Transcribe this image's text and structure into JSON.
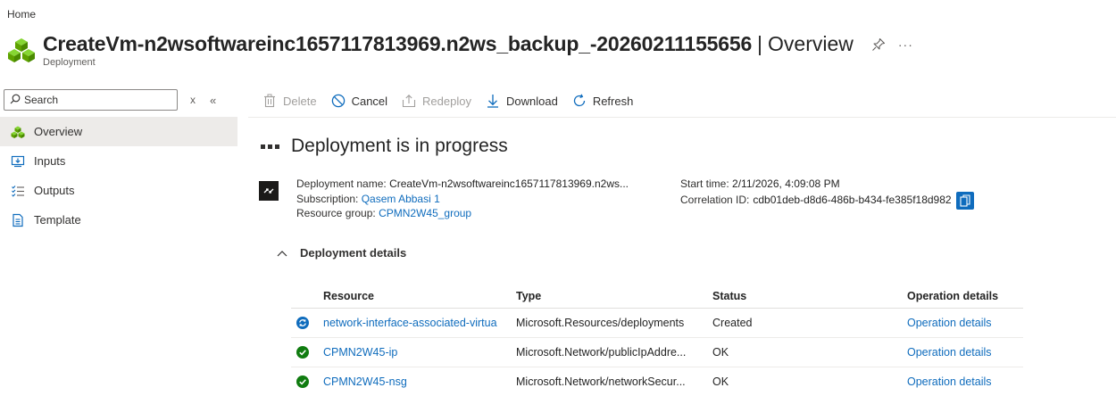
{
  "breadcrumb": {
    "home": "Home"
  },
  "header": {
    "title": "CreateVm-n2wsoftwareinc1657117813969.n2ws_backup_-20260211155656",
    "separator": "|",
    "section": "Overview",
    "subtitle": "Deployment",
    "more": "···"
  },
  "sidebar": {
    "search_placeholder": "Search",
    "close_glyph": "x",
    "collapse_glyph": "«",
    "items": [
      {
        "label": "Overview",
        "icon": "deployment-cubes-icon",
        "active": true
      },
      {
        "label": "Inputs",
        "icon": "inputs-icon"
      },
      {
        "label": "Outputs",
        "icon": "outputs-list-icon"
      },
      {
        "label": "Template",
        "icon": "template-doc-icon"
      }
    ]
  },
  "toolbar": {
    "delete": "Delete",
    "cancel": "Cancel",
    "redeploy": "Redeploy",
    "download": "Download",
    "refresh": "Refresh"
  },
  "status": {
    "heading": "Deployment is in progress"
  },
  "info": {
    "deployment_name_label": "Deployment name:",
    "deployment_name_value": "CreateVm-n2wsoftwareinc1657117813969.n2ws...",
    "subscription_label": "Subscription:",
    "subscription_value": "Qasem Abbasi 1",
    "resource_group_label": "Resource group:",
    "resource_group_value": "CPMN2W45_group",
    "start_time_label": "Start time:",
    "start_time_value": "2/11/2026, 4:09:08 PM",
    "correlation_label": "Correlation ID:",
    "correlation_value": "cdb01deb-d8d6-486b-b434-fe385f18d982"
  },
  "details": {
    "toggle_label": "Deployment details",
    "columns": [
      "Resource",
      "Type",
      "Status",
      "Operation details"
    ],
    "rows": [
      {
        "resource": "network-interface-associated-virtua",
        "type": "Microsoft.Resources/deployments",
        "status": "Created",
        "operation": "Operation details",
        "state": "in-progress"
      },
      {
        "resource": "CPMN2W45-ip",
        "type": "Microsoft.Network/publicIpAddre...",
        "status": "OK",
        "operation": "Operation details",
        "state": "ok"
      },
      {
        "resource": "CPMN2W45-nsg",
        "type": "Microsoft.Network/networkSecur...",
        "status": "OK",
        "operation": "Operation details",
        "state": "ok"
      }
    ]
  },
  "colors": {
    "accent": "#0f6cbd",
    "success": "#107c10",
    "brand_green": "#5ea200"
  }
}
